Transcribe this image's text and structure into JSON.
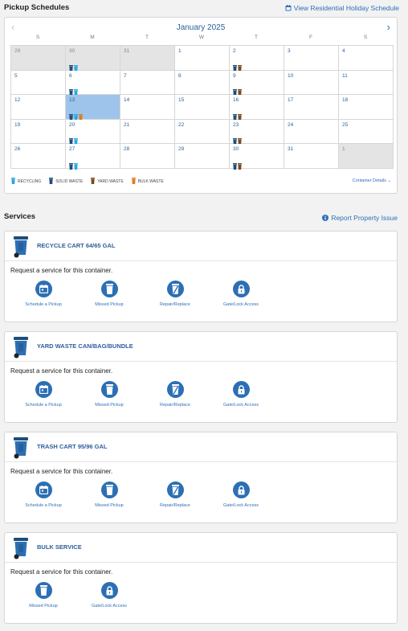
{
  "header": {
    "title": "Pickup Schedules",
    "holiday_link": "View Residential Holiday Schedule"
  },
  "calendar": {
    "month_label": "January 2025",
    "prev_glyph": "‹",
    "next_glyph": "›",
    "weekdays": [
      "S",
      "M",
      "T",
      "W",
      "T",
      "F",
      "S"
    ],
    "days": [
      {
        "n": "29",
        "other": true,
        "bins": []
      },
      {
        "n": "30",
        "other": true,
        "bins": [
          "solid",
          "recycling"
        ]
      },
      {
        "n": "31",
        "other": true,
        "bins": []
      },
      {
        "n": "1",
        "bins": []
      },
      {
        "n": "2",
        "bins": [
          "solid",
          "yard"
        ]
      },
      {
        "n": "3",
        "bins": []
      },
      {
        "n": "4",
        "bins": []
      },
      {
        "n": "5",
        "bins": []
      },
      {
        "n": "6",
        "bins": [
          "solid",
          "recycling"
        ]
      },
      {
        "n": "7",
        "bins": []
      },
      {
        "n": "8",
        "bins": []
      },
      {
        "n": "9",
        "bins": [
          "solid",
          "yard"
        ]
      },
      {
        "n": "10",
        "bins": []
      },
      {
        "n": "11",
        "bins": []
      },
      {
        "n": "12",
        "bins": []
      },
      {
        "n": "13",
        "today": true,
        "bins": [
          "solid",
          "recycling",
          "bulk"
        ]
      },
      {
        "n": "14",
        "bins": []
      },
      {
        "n": "15",
        "bins": []
      },
      {
        "n": "16",
        "bins": [
          "solid",
          "yard"
        ]
      },
      {
        "n": "17",
        "bins": []
      },
      {
        "n": "18",
        "bins": []
      },
      {
        "n": "19",
        "bins": []
      },
      {
        "n": "20",
        "bins": [
          "solid",
          "recycling"
        ]
      },
      {
        "n": "21",
        "bins": []
      },
      {
        "n": "22",
        "bins": []
      },
      {
        "n": "23",
        "bins": [
          "solid",
          "yard"
        ]
      },
      {
        "n": "24",
        "bins": []
      },
      {
        "n": "25",
        "bins": []
      },
      {
        "n": "26",
        "bins": []
      },
      {
        "n": "27",
        "bins": [
          "solid",
          "recycling"
        ]
      },
      {
        "n": "28",
        "bins": []
      },
      {
        "n": "29",
        "bins": []
      },
      {
        "n": "30",
        "bins": [
          "solid",
          "yard"
        ]
      },
      {
        "n": "31",
        "bins": []
      },
      {
        "n": "1",
        "other": true,
        "bins": []
      }
    ],
    "legend": [
      {
        "key": "recycling",
        "label": "RECYCLING"
      },
      {
        "key": "solid",
        "label": "SOLID WASTE"
      },
      {
        "key": "yard",
        "label": "YARD WASTE"
      },
      {
        "key": "bulk",
        "label": "BULK WASTE"
      }
    ],
    "container_details": "Container Details ⌄"
  },
  "colors": {
    "recycling": "#2aa8e0",
    "solid": "#1f4e79",
    "yard": "#7a4a1c",
    "bulk": "#e07b20",
    "accent": "#2c6fb4",
    "today": "#9fc4ec"
  },
  "services": {
    "title": "Services",
    "report_link": "Report Property Issue",
    "prompt": "Request a service for this container.",
    "cards": [
      {
        "title": "RECYCLE CART 64/65 GAL",
        "actions": [
          {
            "label": "Schedule a Pickup",
            "icon": "calendar-icon"
          },
          {
            "label": "Missed Pickup",
            "icon": "bin-icon"
          },
          {
            "label": "Repair/Replace",
            "icon": "broken-bin-icon"
          },
          {
            "label": "Gate/Lock Access",
            "icon": "lock-icon"
          }
        ]
      },
      {
        "title": "YARD WASTE CAN/BAG/BUNDLE",
        "actions": [
          {
            "label": "Schedule a Pickup",
            "icon": "calendar-icon"
          },
          {
            "label": "Missed Pickup",
            "icon": "bin-icon"
          },
          {
            "label": "Repair/Replace",
            "icon": "broken-bin-icon"
          },
          {
            "label": "Gate/Lock Access",
            "icon": "lock-icon"
          }
        ]
      },
      {
        "title": "TRASH CART 95/96 GAL",
        "actions": [
          {
            "label": "Schedule a Pickup",
            "icon": "calendar-icon"
          },
          {
            "label": "Missed Pickup",
            "icon": "bin-icon"
          },
          {
            "label": "Repair/Replace",
            "icon": "broken-bin-icon"
          },
          {
            "label": "Gate/Lock Access",
            "icon": "lock-icon"
          }
        ]
      },
      {
        "title": "BULK SERVICE",
        "actions": [
          {
            "label": "Missed Pickup",
            "icon": "bin-icon"
          },
          {
            "label": "Gate/Lock Access",
            "icon": "lock-icon"
          }
        ]
      }
    ]
  }
}
